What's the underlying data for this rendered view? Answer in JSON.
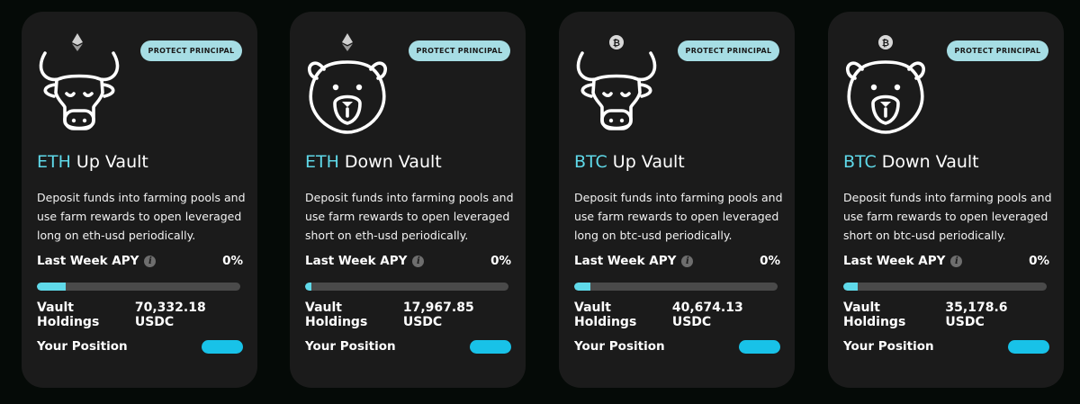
{
  "colors": {
    "accent": "#5fd9e9",
    "badge": "#a6dde4",
    "pill": "#18c2e8",
    "card": "#1b1b1b"
  },
  "vaults": [
    {
      "animal": "bull-icon",
      "coin": "eth-coin-icon",
      "badge": "PROTECT PRINCIPAL",
      "asset": "ETH",
      "name": "Up Vault",
      "description": "Deposit funds into farming pools and use farm rewards to open leveraged long on eth-usd periodically.",
      "apy_label": "Last Week APY",
      "apy_value": "0%",
      "progress": 0.14,
      "holdings_label": "Vault Holdings",
      "holdings_value": "70,332.18 USDC",
      "position_label": "Your Position"
    },
    {
      "animal": "bear-icon",
      "coin": "eth-coin-icon",
      "badge": "PROTECT PRINCIPAL",
      "asset": "ETH",
      "name": "Down Vault",
      "description": "Deposit funds into farming pools and use farm rewards to open leveraged short on eth-usd periodically.",
      "apy_label": "Last Week APY",
      "apy_value": "0%",
      "progress": 0.03,
      "holdings_label": "Vault Holdings",
      "holdings_value": "17,967.85 USDC",
      "position_label": "Your Position"
    },
    {
      "animal": "bull-icon",
      "coin": "btc-coin-icon",
      "badge": "PROTECT PRINCIPAL",
      "asset": "BTC",
      "name": "Up Vault",
      "description": "Deposit funds into farming pools and use farm rewards to open leveraged long on btc-usd periodically.",
      "apy_label": "Last Week APY",
      "apy_value": "0%",
      "progress": 0.08,
      "holdings_label": "Vault Holdings",
      "holdings_value": "40,674.13 USDC",
      "position_label": "Your Position"
    },
    {
      "animal": "bear-icon",
      "coin": "btc-coin-icon",
      "badge": "PROTECT PRINCIPAL",
      "asset": "BTC",
      "name": "Down Vault",
      "description": "Deposit funds into farming pools and use farm rewards to open leveraged short on btc-usd periodically.",
      "apy_label": "Last Week APY",
      "apy_value": "0%",
      "progress": 0.07,
      "holdings_label": "Vault Holdings",
      "holdings_value": "35,178.6 USDC",
      "position_label": "Your Position"
    }
  ]
}
